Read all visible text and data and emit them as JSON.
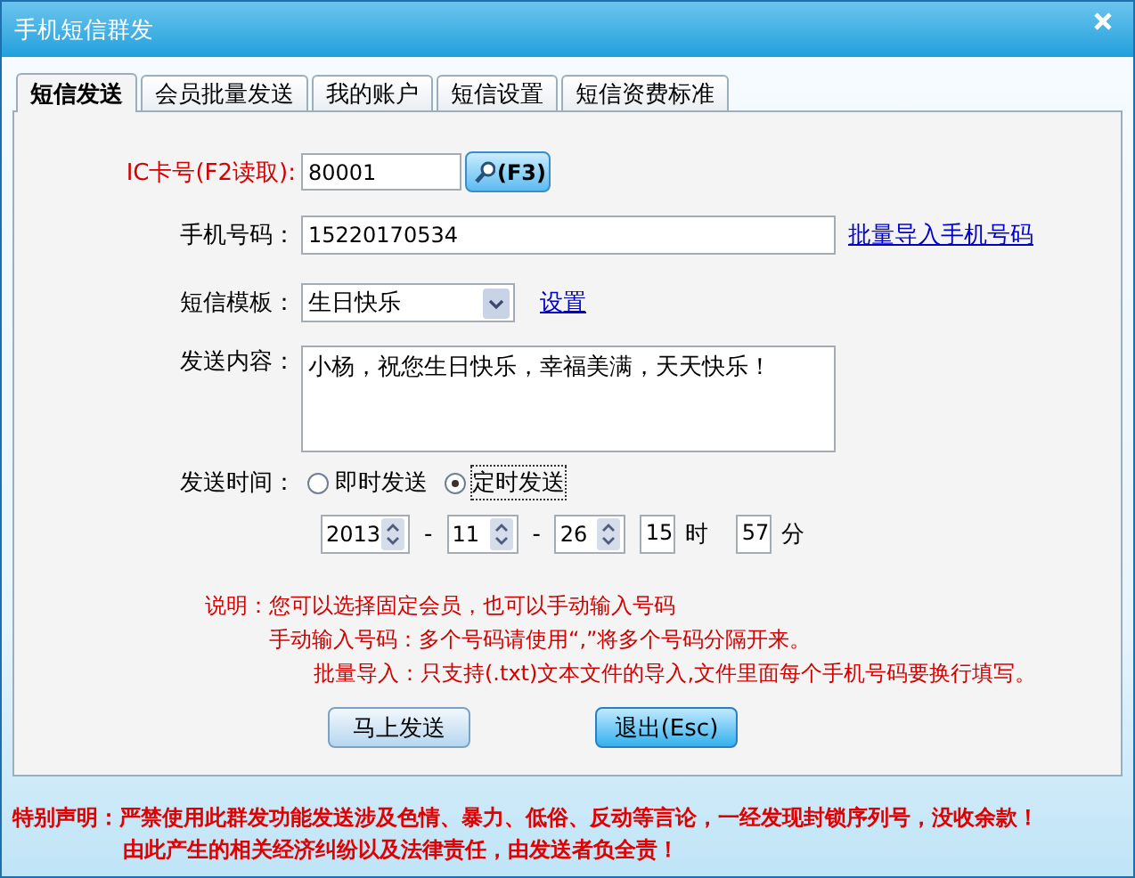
{
  "window": {
    "title": "手机短信群发"
  },
  "tabs": [
    {
      "label": "短信发送",
      "selected": true
    },
    {
      "label": "会员批量发送",
      "selected": false
    },
    {
      "label": "我的账户",
      "selected": false
    },
    {
      "label": "短信设置",
      "selected": false
    },
    {
      "label": "短信资费标准",
      "selected": false
    }
  ],
  "ic_card": {
    "label": "IC卡号(F2读取):",
    "value": "80001",
    "button": "(F3)"
  },
  "phone": {
    "label": "手机号码：",
    "value": "15220170534",
    "link": "批量导入手机号码"
  },
  "template": {
    "label": "短信模板：",
    "value": "生日快乐",
    "link": "设置"
  },
  "content": {
    "label": "发送内容：",
    "value": "小杨，祝您生日快乐，幸福美满，天天快乐！"
  },
  "send_time": {
    "label": "发送时间：",
    "options": [
      {
        "label": "即时发送",
        "selected": false
      },
      {
        "label": "定时发送",
        "selected": true
      }
    ],
    "fields": [
      {
        "kind": "spin",
        "value": "2013"
      },
      {
        "kind": "sep",
        "text": "-"
      },
      {
        "kind": "spin",
        "value": "11"
      },
      {
        "kind": "sep",
        "text": "-"
      },
      {
        "kind": "spin",
        "value": "26"
      },
      {
        "kind": "box",
        "value": "15"
      },
      {
        "kind": "sep",
        "text": "时"
      },
      {
        "kind": "box",
        "value": "57"
      },
      {
        "kind": "sep",
        "text": "分"
      }
    ]
  },
  "notes": [
    "说明：您可以选择固定会员，也可以手动输入号码",
    "手动输入号码：多个号码请使用“,”将多个号码分隔开来。",
    "批量导入：只支持(.txt)文本文件的导入,文件里面每个手机号码要换行填写。"
  ],
  "buttons": [
    {
      "label": "马上发送",
      "default": false
    },
    {
      "label": "退出(Esc)",
      "default": true
    }
  ],
  "disclaimer": [
    "特别声明：严禁使用此群发功能发送涉及色情、暴力、低俗、反动等言论，一经发现封锁序列号，没收余款！",
    "由此产生的相关经济纠纷以及法律责任，由发送者负全责！"
  ]
}
